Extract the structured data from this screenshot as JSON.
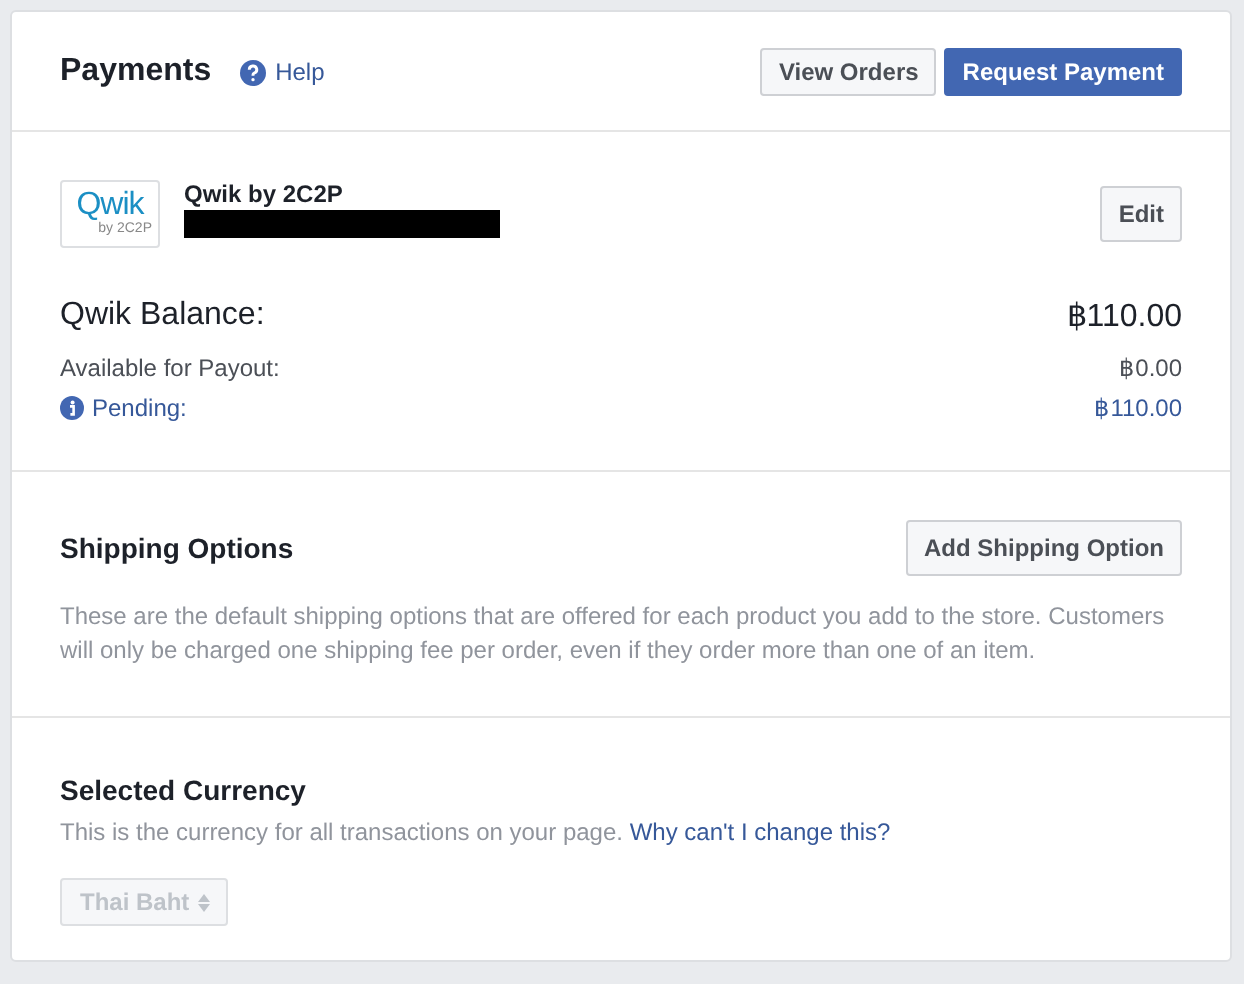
{
  "header": {
    "title": "Payments",
    "help_link": "Help",
    "buttons": [
      {
        "label": "View Orders",
        "kind": "secondary"
      },
      {
        "label": "Request Payment",
        "kind": "primary"
      }
    ]
  },
  "provider": {
    "logo_text": "Qwik",
    "logo_subtext": "by 2C2P",
    "name": "Qwik by 2C2P",
    "account_redacted": true,
    "edit_button": "Edit"
  },
  "balance": {
    "label": "Qwik Balance:",
    "amount": "฿110.00",
    "rows": [
      {
        "label": "Available for Payout:",
        "amount": "฿0.00",
        "kind": "plain"
      },
      {
        "label": "Pending:",
        "amount": "฿110.00",
        "kind": "info"
      }
    ]
  },
  "shipping": {
    "title": "Shipping Options",
    "button": "Add Shipping Option",
    "description": "These are the default shipping options that are offered for each product you add to the store. Customers will only be charged one shipping fee per order, even if they order more than one of an item."
  },
  "currency": {
    "title": "Selected Currency",
    "description": "This is the currency for all transactions on your page.",
    "link": "Why can't I change this?",
    "select": {
      "value": "Thai Baht",
      "disabled": true
    }
  }
}
